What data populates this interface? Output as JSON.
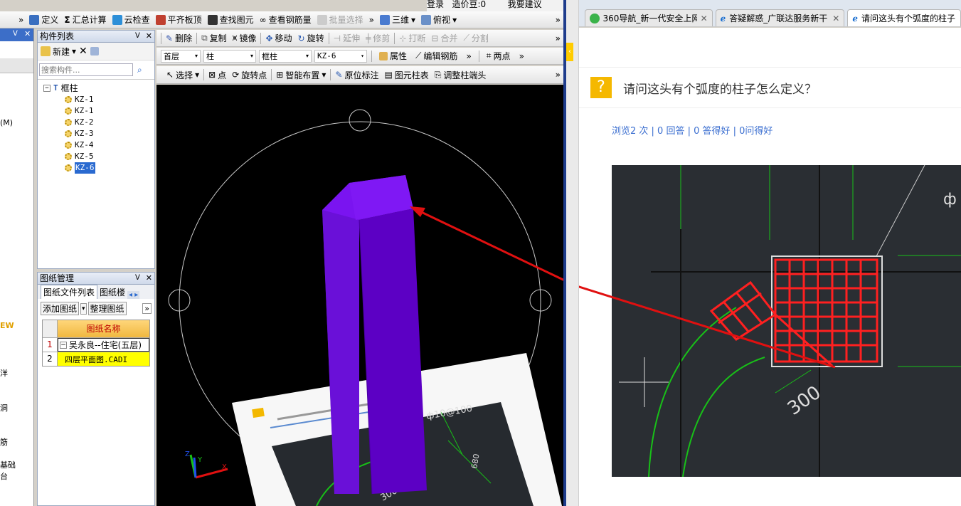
{
  "top_toolbar": {
    "items": [
      "定义",
      "汇总计算",
      "云检查",
      "平齐板顶",
      "查找图元",
      "查看钢筋量",
      "批量选择",
      "三维",
      "俯视"
    ],
    "overflow": "»",
    "top_right": "登录   造价豆:0        我要建议"
  },
  "left_strip": {
    "labels": [
      "(M)",
      "EW",
      "洋",
      "洞",
      "筋",
      "基础",
      "台"
    ]
  },
  "component_list": {
    "title": "构件列表",
    "new_button": "新建",
    "search_placeholder": "搜索构件...",
    "category": "框柱",
    "items": [
      "KZ-1",
      "KZ-1",
      "KZ-2",
      "KZ-3",
      "KZ-4",
      "KZ-5",
      "KZ-6"
    ],
    "selected": "KZ-6"
  },
  "drawing_mgmt": {
    "title": "图纸管理",
    "tabs": [
      "图纸文件列表",
      "图纸楼"
    ],
    "add_button": "添加图纸",
    "arrange_button": "整理图纸",
    "column_header": "图纸名称",
    "rows": [
      {
        "num": "1",
        "name": "吴永良--住宅(五层)"
      },
      {
        "num": "2",
        "name": "四层平面图.CADI"
      }
    ]
  },
  "edit_toolbar": {
    "items": [
      "删除",
      "复制",
      "镜像",
      "移动",
      "旋转",
      "延伸",
      "修剪",
      "打断",
      "合并",
      "分割"
    ]
  },
  "selector_toolbar": {
    "floor": "首层",
    "type": "柱",
    "subtype": "框柱",
    "component": "KZ-6",
    "properties": "属性",
    "edit_rebar": "编辑钢筋",
    "two_points": "两点"
  },
  "draw_toolbar": {
    "items": [
      "选择",
      "点",
      "旋转点",
      "智能布置",
      "原位标注",
      "图元柱表",
      "调整柱端头"
    ]
  },
  "viewport": {
    "insert_image_text": "300"
  },
  "browser": {
    "tabs": [
      {
        "label": "360导航_新一代安全上网"
      },
      {
        "label": "答疑解惑_广联达服务新干"
      },
      {
        "label": "请问这头有个弧度的柱子"
      }
    ],
    "question_title": "请问这头有个弧度的柱子怎么定义？",
    "stats": "浏览2 次 | 0 回答 | 0 答得好 | 0问得好",
    "cad_labels": {
      "dimension": "300",
      "top": "ф"
    }
  },
  "colors": {
    "column": "#6a00d8",
    "accent_yellow": "#ffcc00",
    "rebar": "#ff2020",
    "cad_green": "#18c018"
  }
}
